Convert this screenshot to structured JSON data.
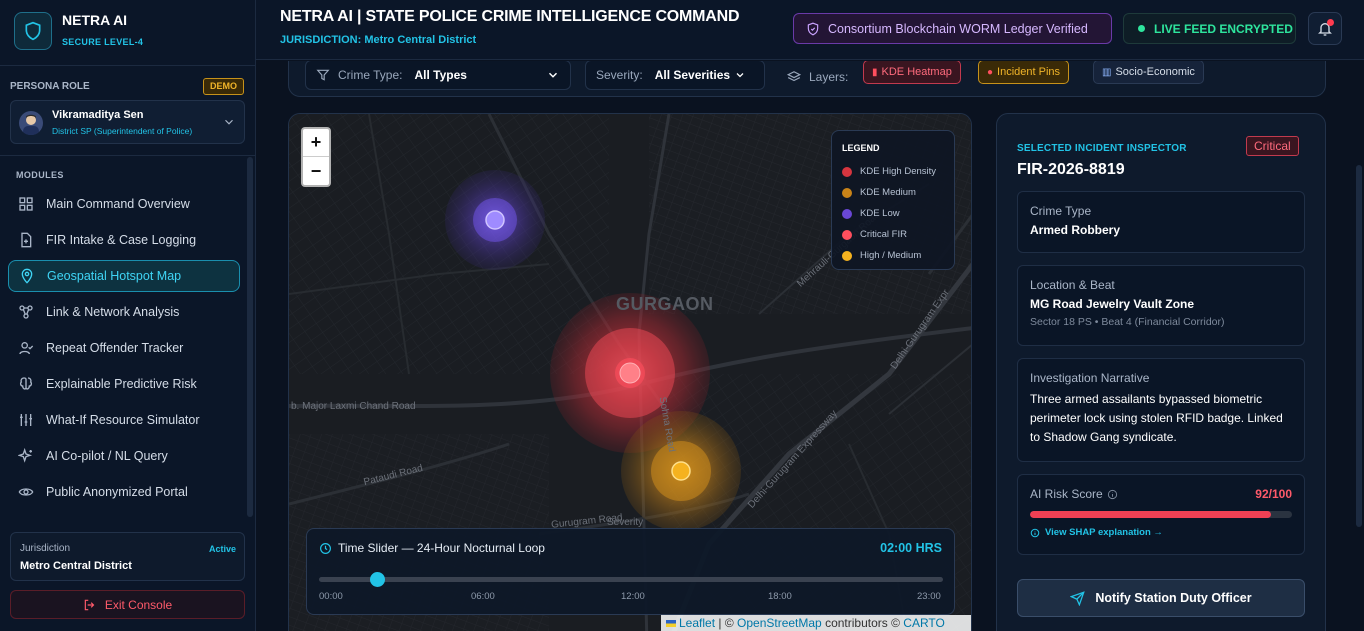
{
  "brand": {
    "title": "NETRA AI",
    "subtitle": "SECURE LEVEL-4"
  },
  "persona": {
    "label": "PERSONA ROLE",
    "badge": "DEMO",
    "name": "Vikramaditya Sen",
    "role": "District SP (Superintendent of Police)"
  },
  "modules": {
    "label": "MODULES",
    "items": [
      {
        "label": "Main Command Overview",
        "icon": "grid-icon"
      },
      {
        "label": "FIR Intake & Case Logging",
        "icon": "file-plus-icon"
      },
      {
        "label": "Geospatial Hotspot Map",
        "icon": "map-pin-icon",
        "active": true
      },
      {
        "label": "Link & Network Analysis",
        "icon": "network-icon"
      },
      {
        "label": "Repeat Offender Tracker",
        "icon": "user-check-icon"
      },
      {
        "label": "Explainable Predictive Risk",
        "icon": "brain-icon"
      },
      {
        "label": "What-If Resource Simulator",
        "icon": "sliders-icon"
      },
      {
        "label": "AI Co-pilot / NL Query",
        "icon": "sparkles-icon"
      },
      {
        "label": "Public Anonymized Portal",
        "icon": "eye-icon"
      }
    ]
  },
  "jurisdiction": {
    "label": "Jurisdiction",
    "status": "Active",
    "value": "Metro Central District"
  },
  "exit_label": "Exit Console",
  "header": {
    "title": "NETRA AI | STATE POLICE CRIME INTELLIGENCE COMMAND",
    "subtitle": "JURISDICTION: Metro Central District",
    "chain_badge": "Consortium Blockchain WORM Ledger Verified",
    "feed_badge": "LIVE FEED ENCRYPTED"
  },
  "filters": {
    "crime_type_label": "Crime Type:",
    "crime_type_value": "All Types",
    "severity_label": "Severity:",
    "severity_value": "All Severities",
    "layers_label": "Layers:",
    "chips": [
      "KDE Heatmap",
      "Incident Pins",
      "Socio-Economic"
    ]
  },
  "map": {
    "zoom_in": "+",
    "zoom_out": "−",
    "legend_title": "LEGEND",
    "legend": [
      {
        "label": "KDE High Density",
        "color": "#d6353f"
      },
      {
        "label": "KDE Medium",
        "color": "#c98318"
      },
      {
        "label": "KDE Low",
        "color": "#6a47d6"
      },
      {
        "label": "Critical FIR",
        "color": "#ff4f5e"
      },
      {
        "label": "High / Medium",
        "color": "#f5b21f"
      }
    ],
    "city_label": "GURGAON",
    "roads": [
      "b. Major Laxmi Chand Road",
      "Pataudi Road",
      "Delhi-Gurugram Expressway",
      "Mehrauli-Gurgaon Road",
      "Delhi-Gurugram Expr",
      "Gurugram Road",
      "Sohna Road",
      "Severity"
    ],
    "slider_title": "Time Slider — 24-Hour Nocturnal Loop",
    "slider_time": "02:00 HRS",
    "slider_fraction": 0.0833,
    "ticks": [
      "00:00",
      "06:00",
      "12:00",
      "18:00",
      "23:00"
    ],
    "attribution_leaflet": "Leaflet",
    "attribution_sep": "| ©",
    "attribution_osm": "OpenStreetMap",
    "attribution_contrib": "contributors ©",
    "attribution_carto": "CARTO"
  },
  "inspector": {
    "label": "SELECTED INCIDENT INSPECTOR",
    "severity": "Critical",
    "fir_id": "FIR-2026-8819",
    "crime_type_label": "Crime Type",
    "crime_type": "Armed Robbery",
    "location_label": "Location & Beat",
    "location": "MG Road Jewelry Vault Zone",
    "beat": "Sector 18 PS • Beat 4 (Financial Corridor)",
    "narrative_label": "Investigation Narrative",
    "narrative": "Three armed assailants bypassed biometric perimeter lock using stolen RFID badge. Linked to Shadow Gang syndicate.",
    "risk_label": "AI Risk Score",
    "risk_score": "92/100",
    "risk_fraction": 0.92,
    "shap_link": "View SHAP explanation →",
    "notify_label": "Notify Station Duty Officer"
  }
}
